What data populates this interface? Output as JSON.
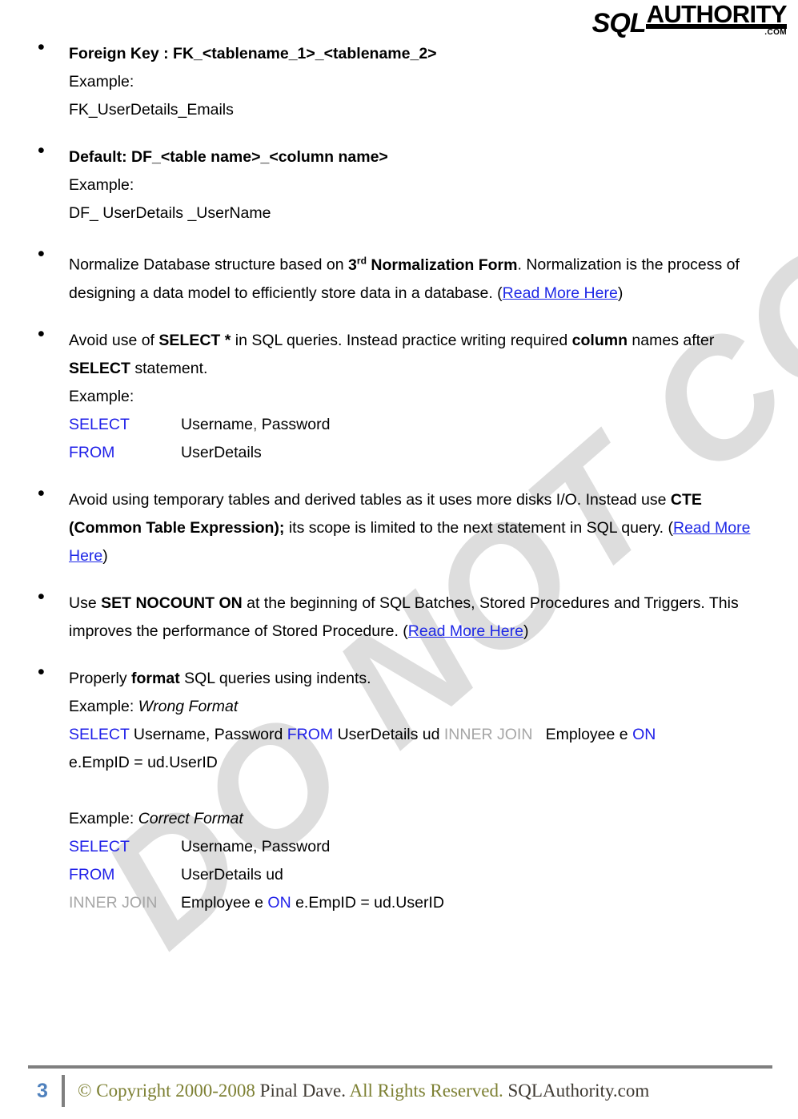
{
  "watermark": {
    "text": "DO NOT COPY"
  },
  "header": {
    "logo": {
      "sql": "SQL",
      "authority": "AUTHORITY",
      "com": ".COM"
    }
  },
  "content": {
    "items": [
      {
        "title_prefix": "Foreign Key : ",
        "title_rest": "FK_<tablename_1>_<tablename_2>",
        "example_label": "Example:",
        "example_value": "FK_UserDetails_Emails"
      },
      {
        "title_prefix": "Default: ",
        "title_rest": "DF_<table name>_<column name>",
        "example_label": "Example:",
        "example_value": "DF_ UserDetails _UserName"
      },
      {
        "p1": "Normalize Database structure based on ",
        "bold1": "3",
        "sup1": "rd",
        "bold2": " Normalization Form",
        "p2": ". Normalization is the process of designing a data model to efficiently store data in a database. (",
        "link1": "Read More Here",
        "p3": ")"
      },
      {
        "p1": "Avoid use of ",
        "bold1": "SELECT *",
        "p2": " in SQL queries. Instead practice writing required ",
        "bold2": "column",
        "p3": " names after ",
        "bold3": "SELECT",
        "p4": " statement.",
        "example_label": "Example:",
        "code": [
          {
            "keyword": "SELECT",
            "body_a": "Username",
            "comma": ",",
            "body_b": " Password"
          },
          {
            "keyword": "FROM",
            "body_a": "UserDetails",
            "comma": "",
            "body_b": ""
          }
        ]
      },
      {
        "p1": "Avoid using temporary tables and derived tables as it uses more disks I/O. Instead use ",
        "bold1": "CTE (Common Table Expression);",
        "p2": " its scope is limited to the next statement in SQL query. (",
        "link1": "Read More Here",
        "p3": ")"
      },
      {
        "p1": "Use ",
        "bold1": "SET NOCOUNT ON",
        "p2": " at the beginning of SQL Batches, Stored Procedures and Triggers. This improves the performance of Stored Procedure. (",
        "link1": "Read More Here",
        "p3": ")"
      },
      {
        "p1": "Properly ",
        "bold1": "format",
        "p2": " SQL queries using indents.",
        "wrong_example_label": "Example: ",
        "wrong_example_italic": "Wrong Format",
        "wrong_kw_select": "SELECT",
        "wrong_t1": " Username, Password ",
        "wrong_kw_from": "FROM",
        "wrong_t2": " UserDetails ud ",
        "wrong_kw_join": "INNER JOIN",
        "wrong_t3": "   Employee e ",
        "wrong_kw_on": "ON",
        "wrong_t4": "",
        "wrong_line2": "e.EmpID = ud.UserID",
        "correct_example_label": "Example: ",
        "correct_example_italic": "Correct Format",
        "correct_code": [
          {
            "keyword": "SELECT",
            "kw_color": "blue",
            "body": "Username, Password"
          },
          {
            "keyword": "FROM",
            "kw_color": "blue",
            "body": "UserDetails ud"
          },
          {
            "keyword": "INNER JOIN",
            "kw_color": "gray",
            "body_a": "Employee e ",
            "body_kw": "ON",
            "body_b": " e.EmpID = ud.UserID"
          }
        ]
      }
    ]
  },
  "footer": {
    "page_number": "3",
    "copyright": "© Copyright 2000-2008 ",
    "author": "Pinal Dave. ",
    "rights": "All Rights Reserved. ",
    "site": "SQLAuthority.com"
  },
  "colors": {
    "link": "#1e28e6",
    "keyword": "#1f1fe8",
    "keyword_gray": "#a6a6a6",
    "page_number": "#4f81bd",
    "footer_olive": "#7d8033",
    "footer_dark": "#3f3a33",
    "watermark": "#dddddd",
    "rule": "#7f7f7f"
  }
}
